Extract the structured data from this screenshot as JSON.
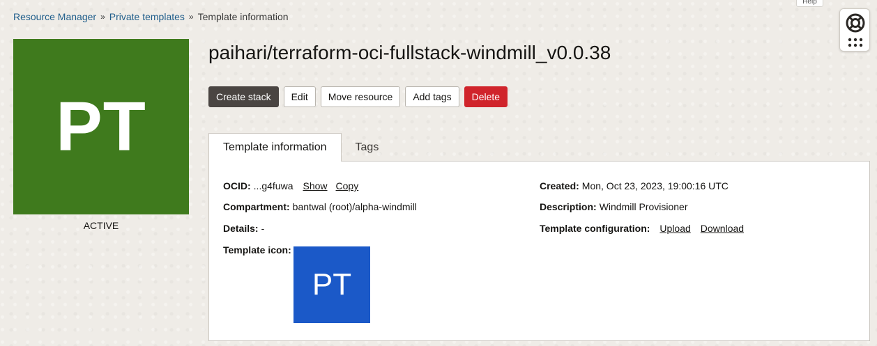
{
  "breadcrumb": {
    "items": [
      "Resource Manager",
      "Private templates",
      "Template information"
    ],
    "separator": "»"
  },
  "help": {
    "tab_label": "Help"
  },
  "template": {
    "icon_text": "PT",
    "status": "ACTIVE",
    "title": "paihari/terraform-oci-fullstack-windmill_v0.0.38"
  },
  "actions": {
    "create_stack": "Create stack",
    "edit": "Edit",
    "move_resource": "Move resource",
    "add_tags": "Add tags",
    "delete": "Delete"
  },
  "tabs": [
    {
      "label": "Template information",
      "active": true
    },
    {
      "label": "Tags",
      "active": false
    }
  ],
  "details": {
    "ocid": {
      "label": "OCID:",
      "value": "...g4fuwa",
      "show": "Show",
      "copy": "Copy"
    },
    "compartment": {
      "label": "Compartment:",
      "value": "bantwal (root)/alpha-windmill"
    },
    "details": {
      "label": "Details:",
      "value": "-"
    },
    "template_icon": {
      "label": "Template icon:",
      "icon_text": "PT"
    },
    "created": {
      "label": "Created:",
      "value": "Mon, Oct 23, 2023, 19:00:16 UTC"
    },
    "description": {
      "label": "Description:",
      "value": "Windmill Provisioner"
    },
    "template_configuration": {
      "label": "Template configuration:",
      "upload": "Upload",
      "download": "Download"
    }
  },
  "colors": {
    "big_icon_bg": "#3f7a1d",
    "template_icon_bg": "#1b59c8",
    "primary_button": "#4a4542",
    "danger_button": "#d0242b"
  }
}
